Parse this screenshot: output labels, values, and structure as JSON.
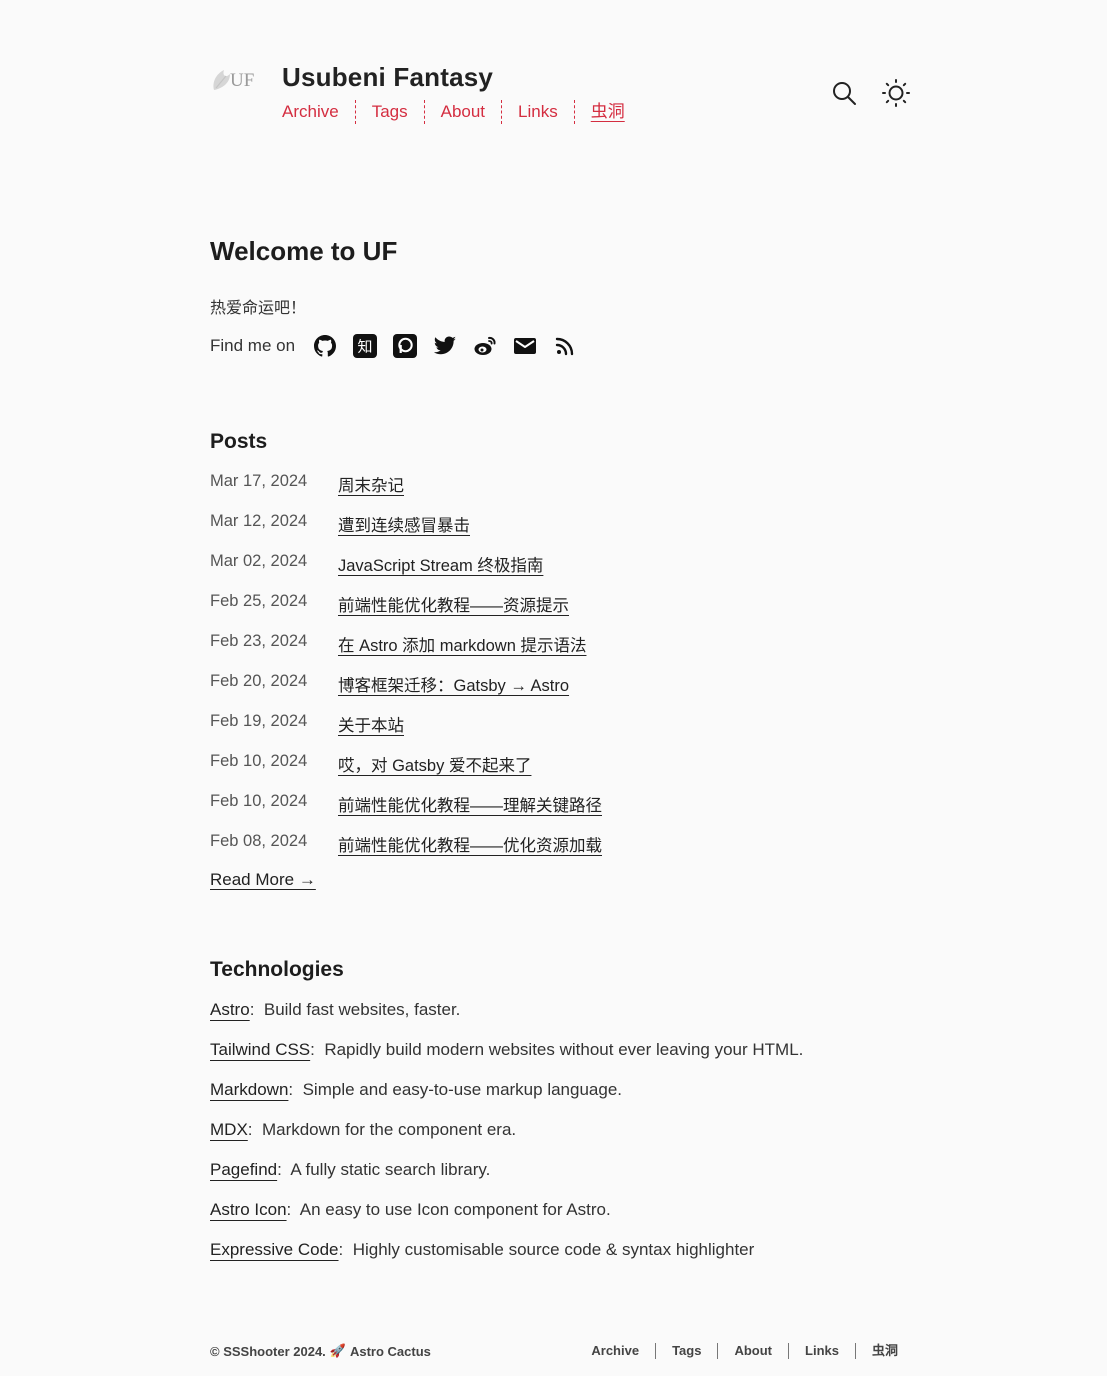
{
  "site": {
    "logo_text": "UF",
    "title": "Usubeni Fantasy"
  },
  "nav": {
    "items": [
      "Archive",
      "Tags",
      "About",
      "Links",
      "虫洞"
    ]
  },
  "header_icons": [
    "search-icon",
    "sun-icon"
  ],
  "intro": {
    "heading": "Welcome to UF",
    "tagline": "热爱命运吧！",
    "find_me_label": "Find me on",
    "social_icons": [
      "github-icon",
      "zhihu-icon",
      "patreon-icon",
      "twitter-icon",
      "weibo-icon",
      "mail-icon",
      "rss-icon"
    ],
    "zhihu_glyph": "知"
  },
  "posts": {
    "heading": "Posts",
    "items": [
      {
        "date": "Mar 17, 2024",
        "title": "周末杂记"
      },
      {
        "date": "Mar 12, 2024",
        "title": "遭到连续感冒暴击"
      },
      {
        "date": "Mar 02, 2024",
        "title": "JavaScript Stream 终极指南"
      },
      {
        "date": "Feb 25, 2024",
        "title": "前端性能优化教程——资源提示"
      },
      {
        "date": "Feb 23, 2024",
        "title": "在 Astro 添加 markdown 提示语法"
      },
      {
        "date": "Feb 20, 2024",
        "title": "博客框架迁移：Gatsby → Astro"
      },
      {
        "date": "Feb 19, 2024",
        "title": "关于本站"
      },
      {
        "date": "Feb 10, 2024",
        "title": "哎，对 Gatsby 爱不起来了"
      },
      {
        "date": "Feb 10, 2024",
        "title": "前端性能优化教程——理解关键路径"
      },
      {
        "date": "Feb 08, 2024",
        "title": "前端性能优化教程——优化资源加载"
      }
    ],
    "read_more": "Read More →"
  },
  "technologies": {
    "heading": "Technologies",
    "items": [
      {
        "name": "Astro",
        "desc": "Build fast websites, faster."
      },
      {
        "name": "Tailwind CSS",
        "desc": "Rapidly build modern websites without ever leaving your HTML."
      },
      {
        "name": "Markdown",
        "desc": "Simple and easy-to-use markup language."
      },
      {
        "name": "MDX",
        "desc": "Markdown for the component era."
      },
      {
        "name": "Pagefind",
        "desc": "A fully static search library."
      },
      {
        "name": "Astro Icon",
        "desc": "An easy to use Icon component for Astro."
      },
      {
        "name": "Expressive Code",
        "desc": "Highly customisable source code & syntax highlighter"
      }
    ]
  },
  "footer": {
    "copyright": "© SSShooter 2024.",
    "rocket_glyph": "🚀",
    "theme_credit": "Astro Cactus",
    "nav": [
      "Archive",
      "Tags",
      "About",
      "Links",
      "虫洞"
    ]
  }
}
